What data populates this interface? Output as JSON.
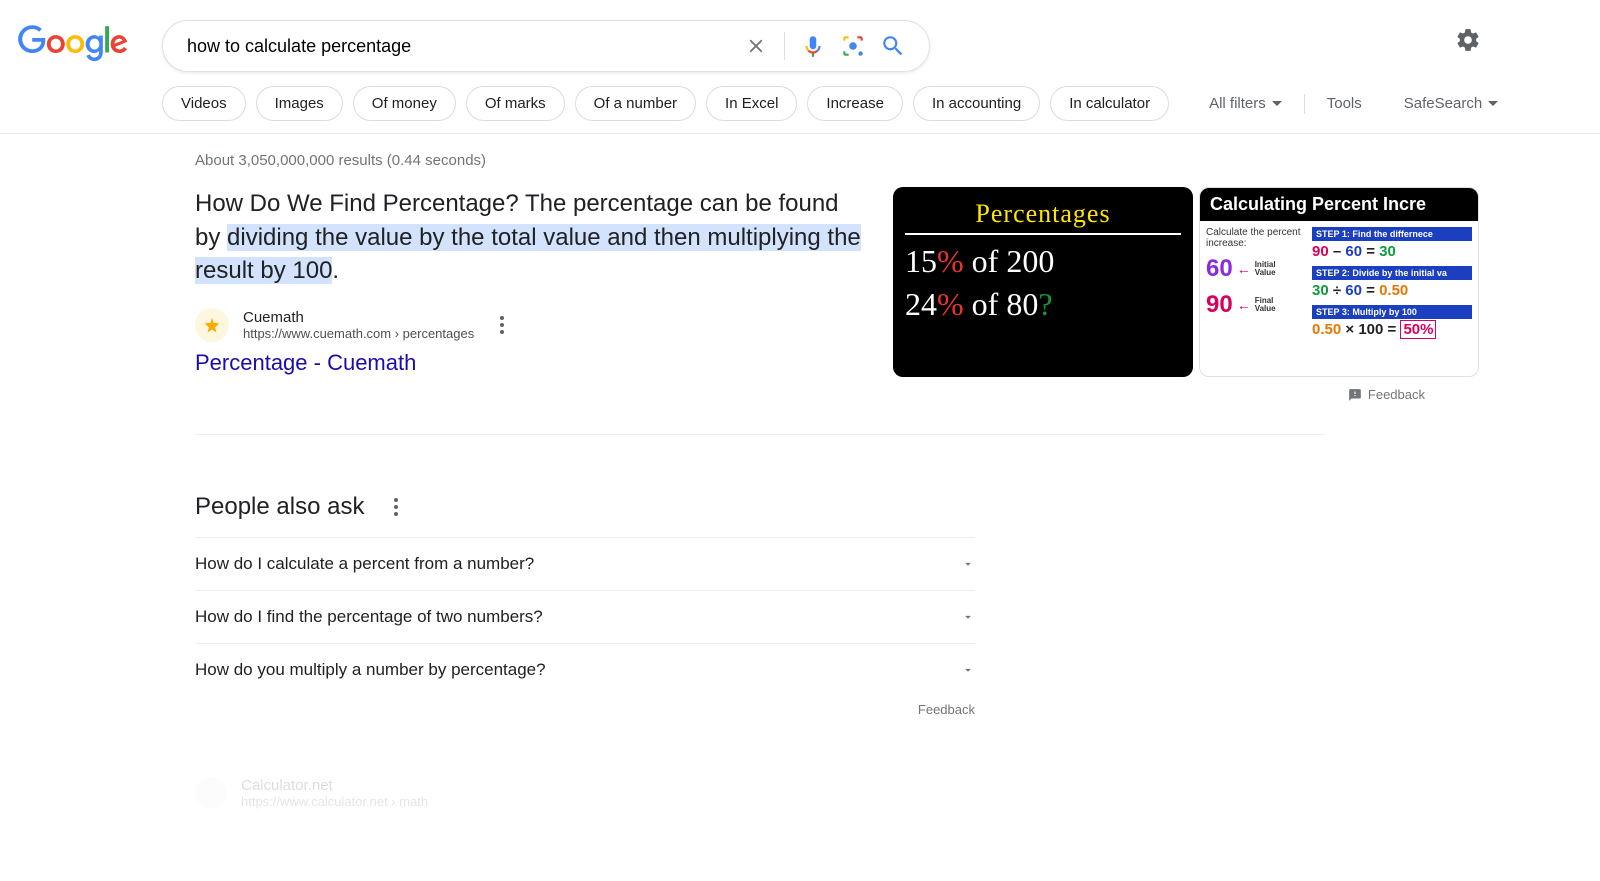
{
  "search": {
    "query": "how to calculate percentage"
  },
  "chips": [
    "Videos",
    "Images",
    "Of money",
    "Of marks",
    "Of a number",
    "In Excel",
    "Increase",
    "In accounting",
    "In calculator"
  ],
  "tools": {
    "all_filters": "All filters",
    "tools": "Tools",
    "safesearch": "SafeSearch"
  },
  "stats": "About 3,050,000,000 results (0.44 seconds)",
  "featured": {
    "text_plain": "How Do We Find Percentage? The percentage can be found by ",
    "text_highlight": "dividing the value by the total value and then multiplying the result by 100",
    "text_tail": ".",
    "source_name": "Cuemath",
    "source_url": "https://www.cuemath.com › percentages",
    "title": "Percentage - Cuemath"
  },
  "thumb1": {
    "title": "Percentages",
    "line1a": "15",
    "line1b": "%",
    "line1c": " of 200",
    "line2a": "24",
    "line2b": "%",
    "line2c": " of 80",
    "line2q": "?"
  },
  "thumb2": {
    "title": "Calculating Percent Incre",
    "left_caption": "Calculate the percent increase:",
    "n60": "60",
    "lab60a": "Initial",
    "lab60b": "Value",
    "n90": "90",
    "lab90a": "Final",
    "lab90b": "Value",
    "step1h": "STEP 1:  Find the differnece",
    "step1e_a": "90",
    "step1e_b": " – ",
    "step1e_c": "60",
    "step1e_d": " = ",
    "step1e_e": "30",
    "step2h": "STEP 2:  Divide by the initial va",
    "step2e_a": "30",
    "step2e_b": " ÷ ",
    "step2e_c": "60",
    "step2e_d": " = ",
    "step2e_e": "0.50",
    "step3h": "STEP 3:  Multiply by 100",
    "step3e_a": "0.50",
    "step3e_b": " × ",
    "step3e_c": "100",
    "step3e_d": " = ",
    "step3e_e": "50%"
  },
  "feedback_label": "Feedback",
  "paa": {
    "title": "People also ask",
    "items": [
      "How do I calculate a percent from a number?",
      "How do I find the percentage of two numbers?",
      "How do you multiply a number by percentage?"
    ],
    "feedback": "Feedback"
  },
  "next_result": {
    "name": "Calculator.net",
    "url": "https://www.calculator.net › math"
  }
}
